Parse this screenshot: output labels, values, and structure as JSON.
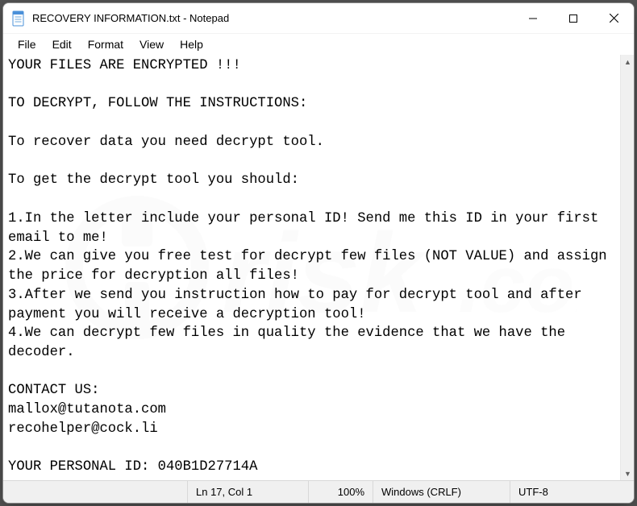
{
  "titlebar": {
    "title": "RECOVERY INFORMATION.txt - Notepad"
  },
  "menu": {
    "file": "File",
    "edit": "Edit",
    "format": "Format",
    "view": "View",
    "help": "Help"
  },
  "content": "YOUR FILES ARE ENCRYPTED !!!\n\nTO DECRYPT, FOLLOW THE INSTRUCTIONS:\n\nTo recover data you need decrypt tool.\n\nTo get the decrypt tool you should:\n\n1.In the letter include your personal ID! Send me this ID in your first email to me!\n2.We can give you free test for decrypt few files (NOT VALUE) and assign the price for decryption all files!\n3.After we send you instruction how to pay for decrypt tool and after payment you will receive a decryption tool!\n4.We can decrypt few files in quality the evidence that we have the decoder.\n\nCONTACT US:\nmallox@tutanota.com\nrecohelper@cock.li\n\nYOUR PERSONAL ID: 040B1D27714A",
  "status": {
    "position": "Ln 17, Col 1",
    "zoom": "100%",
    "line_ending": "Windows (CRLF)",
    "encoding": "UTF-8"
  }
}
